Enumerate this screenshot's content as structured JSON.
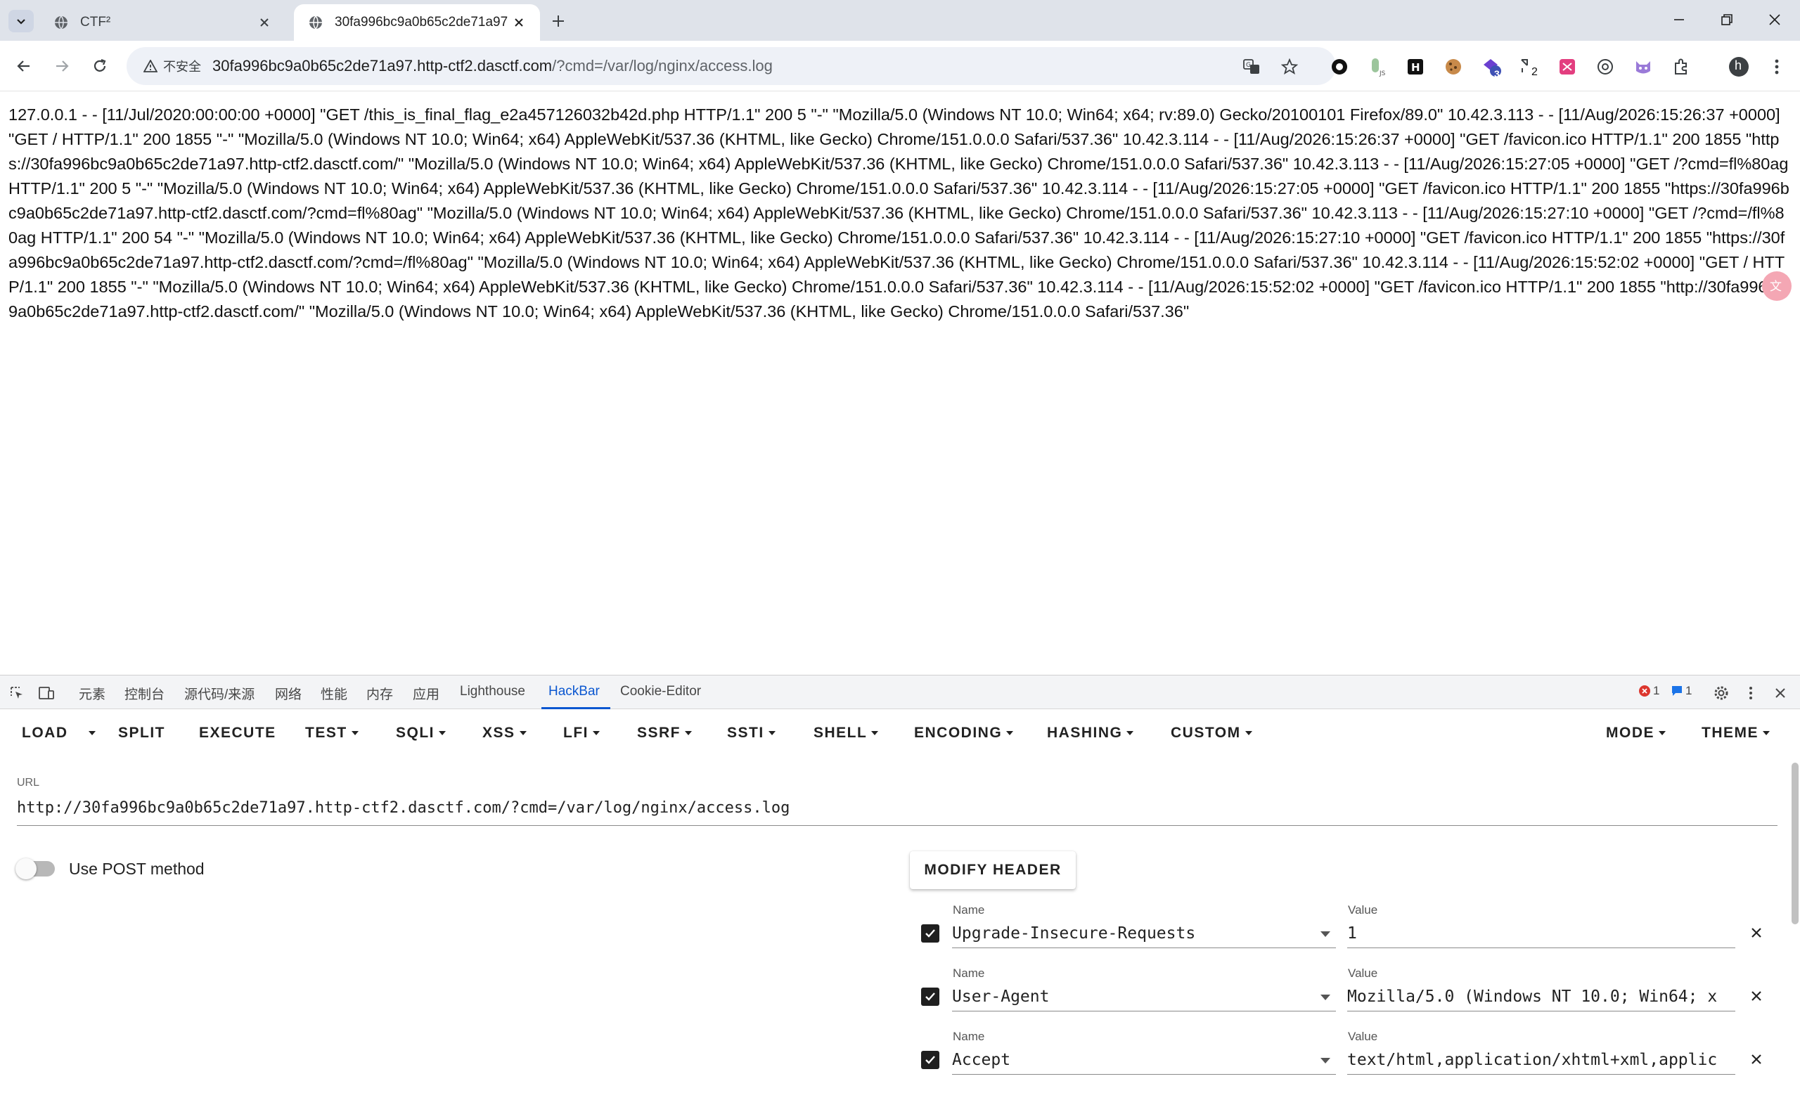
{
  "tabs": [
    {
      "title": "CTF²",
      "active": false
    },
    {
      "title": "30fa996bc9a0b65c2de71a97",
      "active": true
    }
  ],
  "omnibox": {
    "security_label": "不安全",
    "host": "30fa996bc9a0b65c2de71a97.http-ctf2.dasctf.com",
    "path": "/?cmd=/var/log/nginx/access.log"
  },
  "extensions": {
    "badge_count": "3",
    "split_count": "2",
    "profile_initial": "h"
  },
  "page": {
    "log_text": "127.0.0.1 - - [11/Jul/2020:00:00:00 +0000] \"GET /this_is_final_flag_e2a457126032b42d.php HTTP/1.1\" 200 5 \"-\" \"Mozilla/5.0 (Windows NT 10.0; Win64; x64; rv:89.0) Gecko/20100101 Firefox/89.0\" 10.42.3.113 - - [11/Aug/2026:15:26:37 +0000] \"GET / HTTP/1.1\" 200 1855 \"-\" \"Mozilla/5.0 (Windows NT 10.0; Win64; x64) AppleWebKit/537.36 (KHTML, like Gecko) Chrome/151.0.0.0 Safari/537.36\" 10.42.3.114 - - [11/Aug/2026:15:26:37 +0000] \"GET /favicon.ico HTTP/1.1\" 200 1855 \"https://30fa996bc9a0b65c2de71a97.http-ctf2.dasctf.com/\" \"Mozilla/5.0 (Windows NT 10.0; Win64; x64) AppleWebKit/537.36 (KHTML, like Gecko) Chrome/151.0.0.0 Safari/537.36\" 10.42.3.113 - - [11/Aug/2026:15:27:05 +0000] \"GET /?cmd=fl%80ag HTTP/1.1\" 200 5 \"-\" \"Mozilla/5.0 (Windows NT 10.0; Win64; x64) AppleWebKit/537.36 (KHTML, like Gecko) Chrome/151.0.0.0 Safari/537.36\" 10.42.3.114 - - [11/Aug/2026:15:27:05 +0000] \"GET /favicon.ico HTTP/1.1\" 200 1855 \"https://30fa996bc9a0b65c2de71a97.http-ctf2.dasctf.com/?cmd=fl%80ag\" \"Mozilla/5.0 (Windows NT 10.0; Win64; x64) AppleWebKit/537.36 (KHTML, like Gecko) Chrome/151.0.0.0 Safari/537.36\" 10.42.3.113 - - [11/Aug/2026:15:27:10 +0000] \"GET /?cmd=/fl%80ag HTTP/1.1\" 200 54 \"-\" \"Mozilla/5.0 (Windows NT 10.0; Win64; x64) AppleWebKit/537.36 (KHTML, like Gecko) Chrome/151.0.0.0 Safari/537.36\" 10.42.3.114 - - [11/Aug/2026:15:27:10 +0000] \"GET /favicon.ico HTTP/1.1\" 200 1855 \"https://30fa996bc9a0b65c2de71a97.http-ctf2.dasctf.com/?cmd=/fl%80ag\" \"Mozilla/5.0 (Windows NT 10.0; Win64; x64) AppleWebKit/537.36 (KHTML, like Gecko) Chrome/151.0.0.0 Safari/537.36\" 10.42.3.114 - - [11/Aug/2026:15:52:02 +0000] \"GET / HTTP/1.1\" 200 1855 \"-\" \"Mozilla/5.0 (Windows NT 10.0; Win64; x64) AppleWebKit/537.36 (KHTML, like Gecko) Chrome/151.0.0.0 Safari/537.36\" 10.42.3.114 - - [11/Aug/2026:15:52:02 +0000] \"GET /favicon.ico HTTP/1.1\" 200 1855 \"http://30fa996bc9a0b65c2de71a97.http-ctf2.dasctf.com/\" \"Mozilla/5.0 (Windows NT 10.0; Win64; x64) AppleWebKit/537.36 (KHTML, like Gecko) Chrome/151.0.0.0 Safari/537.36\""
  },
  "devtools": {
    "tabs": [
      "元素",
      "控制台",
      "源代码/来源",
      "网络",
      "性能",
      "内存",
      "应用",
      "Lighthouse",
      "HackBar",
      "Cookie-Editor"
    ],
    "active_tab": "HackBar",
    "error_count": "1",
    "message_count": "1"
  },
  "hackbar": {
    "menu": {
      "load": "LOAD",
      "split": "SPLIT",
      "execute": "EXECUTE",
      "test": "TEST",
      "sqli": "SQLI",
      "xss": "XSS",
      "lfi": "LFI",
      "ssrf": "SSRF",
      "ssti": "SSTI",
      "shell": "SHELL",
      "encoding": "ENCODING",
      "hashing": "HASHING",
      "custom": "CUSTOM",
      "mode": "MODE",
      "theme": "THEME"
    },
    "url_label": "URL",
    "url_value": "http://30fa996bc9a0b65c2de71a97.http-ctf2.dasctf.com/?cmd=/var/log/nginx/access.log",
    "post_label": "Use POST method",
    "post_enabled": false,
    "modify_header_label": "MODIFY HEADER",
    "name_label": "Name",
    "value_label": "Value",
    "headers": [
      {
        "enabled": true,
        "name": "Upgrade-Insecure-Requests",
        "value": "1"
      },
      {
        "enabled": true,
        "name": "User-Agent",
        "value": "Mozilla/5.0 (Windows NT 10.0; Win64; x"
      },
      {
        "enabled": true,
        "name": "Accept",
        "value": "text/html,application/xhtml+xml,applic"
      }
    ]
  }
}
